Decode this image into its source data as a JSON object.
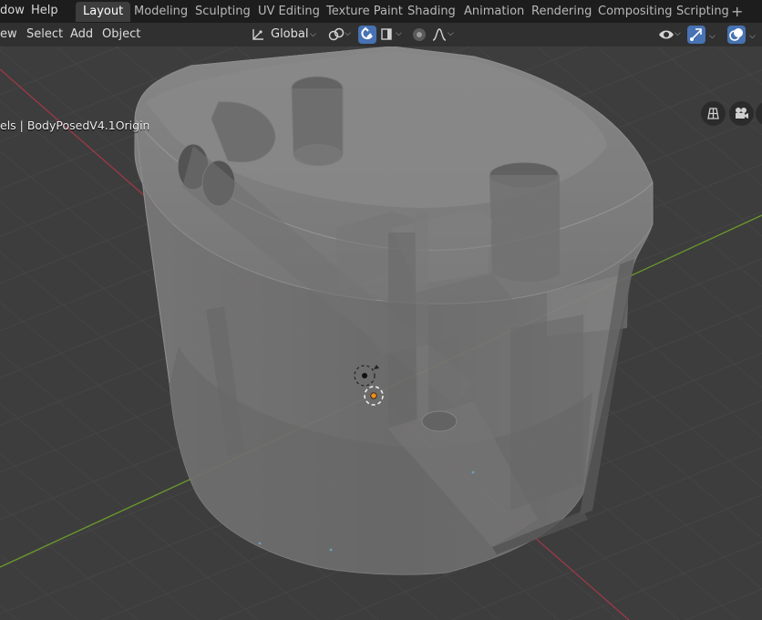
{
  "menu": {
    "window_label": "dow",
    "help_label": "Help"
  },
  "workspace_tabs": [
    {
      "label": "Layout",
      "active": true
    },
    {
      "label": "Modeling"
    },
    {
      "label": "Sculpting"
    },
    {
      "label": "UV Editing"
    },
    {
      "label": "Texture Paint"
    },
    {
      "label": "Shading"
    },
    {
      "label": "Animation"
    },
    {
      "label": "Rendering"
    },
    {
      "label": "Compositing"
    },
    {
      "label": "Scripting"
    }
  ],
  "header": {
    "view_label": "ew",
    "select_label": "Select",
    "add_label": "Add",
    "object_label": "Object",
    "transform_orientation": "Global"
  },
  "viewport": {
    "object_info": "els | BodyPosedV4.1Origin"
  },
  "colors": {
    "accent": "#4772b3",
    "x_axis": "#9b3a48",
    "y_axis": "#6a9a2c",
    "origin": "#f08c1a"
  },
  "icons": [
    "transform-pivot-icon",
    "snap-icon",
    "magnet-icon",
    "proportional-edit-icon",
    "falloff-icon",
    "visibility-icon",
    "gizmo-icon",
    "overlay-icon",
    "grid-view-icon",
    "camera-icon"
  ]
}
